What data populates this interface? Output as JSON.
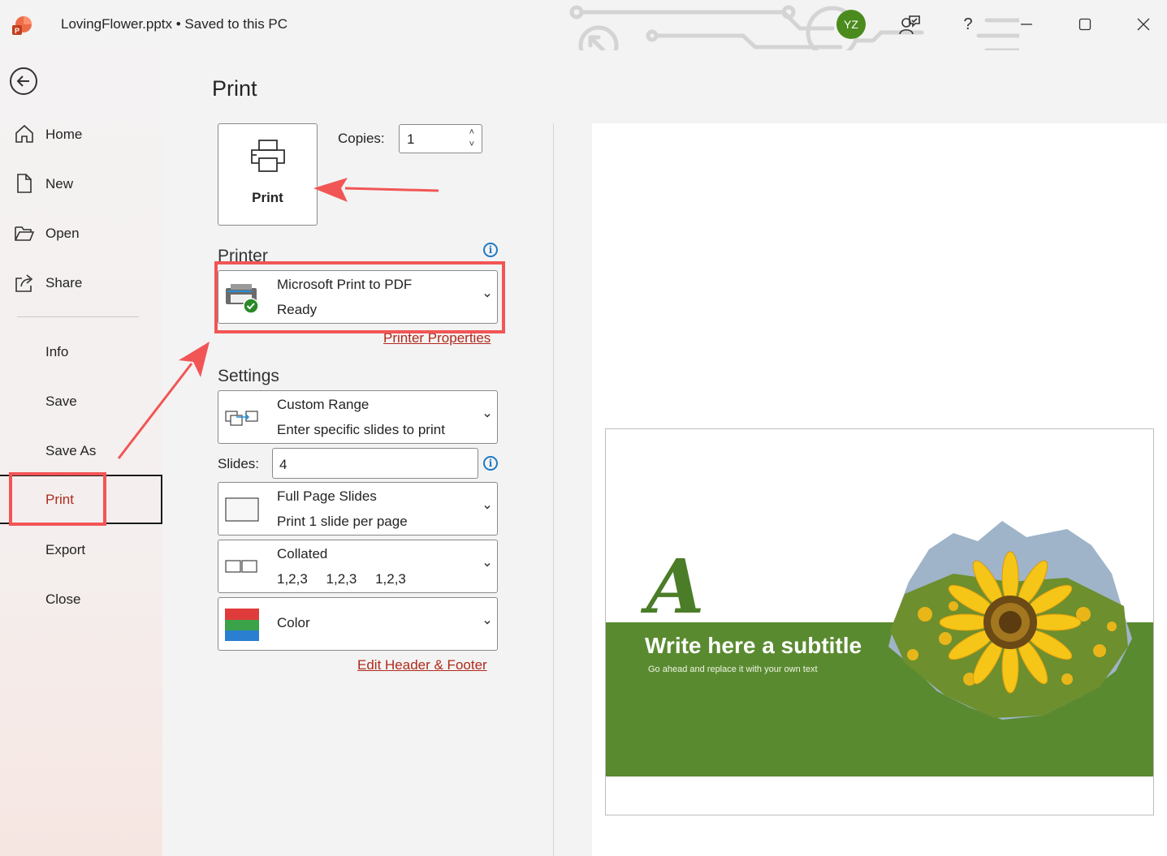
{
  "titlebar": {
    "document_title": "LovingFlower.pptx  •  Saved to this PC",
    "avatar_initials": "YZ",
    "icons": [
      "powerpoint-logo",
      "coauthor-icon",
      "help-icon",
      "minimize-icon",
      "maximize-icon",
      "close-icon"
    ],
    "help_label": "?"
  },
  "nav": {
    "back_icon": "back-arrow-icon",
    "top_items": [
      {
        "label": "Home",
        "icon": "home-icon"
      },
      {
        "label": "New",
        "icon": "new-document-icon"
      },
      {
        "label": "Open",
        "icon": "open-folder-icon"
      },
      {
        "label": "Share",
        "icon": "share-icon"
      }
    ],
    "bottom_items": [
      {
        "label": "Info"
      },
      {
        "label": "Save"
      },
      {
        "label": "Save As"
      },
      {
        "label": "Print",
        "selected": true
      },
      {
        "label": "Export"
      },
      {
        "label": "Close"
      }
    ]
  },
  "print": {
    "page_title": "Print",
    "print_button_label": "Print",
    "copies_label": "Copies:",
    "copies_value": "1",
    "printer_section": "Printer",
    "printer_name": "Microsoft Print to PDF",
    "printer_status": "Ready",
    "printer_properties_link": "Printer Properties",
    "settings_section": "Settings",
    "range_title": "Custom Range",
    "range_desc": "Enter specific slides to print",
    "slides_label": "Slides:",
    "slides_value": "4",
    "layout_title": "Full Page Slides",
    "layout_desc": "Print 1 slide per page",
    "collate_title": "Collated",
    "collate_desc": "1,2,3    1,2,3    1,2,3",
    "color_label": "Color",
    "header_footer_link": "Edit Header & Footer"
  },
  "preview": {
    "slide_letter": "A",
    "slide_title": "Write here a subtitle",
    "slide_subtitle": "Go ahead and replace it with your own text"
  },
  "colors": {
    "accent_red": "#b02a1c",
    "annotation_red": "#f25555",
    "slide_green": "#5a8a30",
    "avatar_green": "#4b8b1e",
    "info_blue": "#1f7ac4"
  }
}
